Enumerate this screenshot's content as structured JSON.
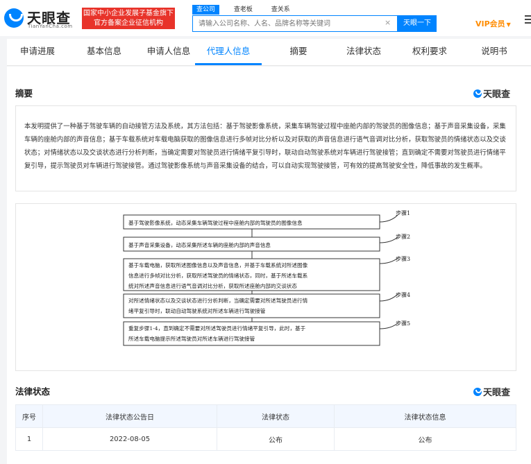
{
  "header": {
    "logo_cn": "天眼查",
    "logo_en": "TianYanCha.com",
    "badge_line1": "国家中小企业发展子基金旗下",
    "badge_line2": "官方备案企业征信机构",
    "search_tabs": [
      "查公司",
      "查老板",
      "查关系"
    ],
    "search_placeholder": "请输入公司名称、人名、品牌名称等关键词",
    "search_clear": "×",
    "search_button": "天眼一下",
    "vip_label": "VIP会员"
  },
  "nav": {
    "tabs": [
      "申请进展",
      "基本信息",
      "申请人信息",
      "代理人信息",
      "摘要",
      "法律状态",
      "权利要求",
      "说明书"
    ],
    "active": "代理人信息"
  },
  "abstract": {
    "title": "摘要",
    "brand": "天眼查",
    "text": "本发明提供了一种基于驾驶车辆的自动接管方法及系统，其方法包括：基于驾驶影像系统，采集车辆驾驶过程中座舱内部的驾驶员的图像信息；基于声音采集设备，采集车辆的座舱内部的声音信息；基于车载系统对车载电脑获取的图像信息进行多帧对比分析以及对获取的声音信息进行语气音调对比分析，获取驾驶员的情绪状态以及交谈状态；对情绪状态以及交谈状态进行分析判断，当确定需要对驾驶员进行情绪平复引导时，联动自动驾驶系统对车辆进行驾驶接管；直到确定不需要对驾驶员进行情绪平复引导，提示驾驶员对车辆进行驾驶接管。通过驾驶影像系统与声音采集设备的结合，可以自动实现驾驶接管，可有效的提高驾驶安全性，降低事故的发生概率。"
  },
  "diagram": {
    "steps": [
      {
        "label": "步骤1",
        "lines": [
          "基于驾驶影像系统，动态采集车辆驾驶过程中座舱内部的驾驶员的图像信息"
        ]
      },
      {
        "label": "步骤2",
        "lines": [
          "基于声音采集设备，动态采集所述车辆的座舱内部的声音信息"
        ]
      },
      {
        "label": "步骤3",
        "lines": [
          "基于车载电脑，获取所述图像信息以及声音信息，并基于车载系统对所述图像",
          "信息进行多帧对比分析，获取所述驾驶员的情绪状态，同时，基于所述车载系",
          "统对所述声音信息进行语气音调对比分析，获取所述座舱内部的交谈状态"
        ]
      },
      {
        "label": "步骤4",
        "lines": [
          "对所述情绪状态以及交谈状态进行分析判断，当确定需要对所述驾驶员进行情",
          "绪平复引导时，联动自动驾驶系统对所述车辆进行驾驶接管"
        ]
      },
      {
        "label": "步骤5",
        "lines": [
          "重复步骤1-4，直到确定不需要对所述驾驶员进行情绪平复引导，此时，基于",
          "所述车载电脑提示所述驾驶员对所述车辆进行驾驶接管"
        ]
      }
    ]
  },
  "legal": {
    "title": "法律状态",
    "brand": "天眼查",
    "columns": [
      "序号",
      "法律状态公告日",
      "法律状态",
      "法律状态信息"
    ],
    "rows": [
      [
        "1",
        "2022-08-05",
        "公布",
        "公布"
      ]
    ]
  },
  "colors": {
    "accent": "#0084ff",
    "badge": "#e8332a",
    "vip": "#ff8c00"
  }
}
